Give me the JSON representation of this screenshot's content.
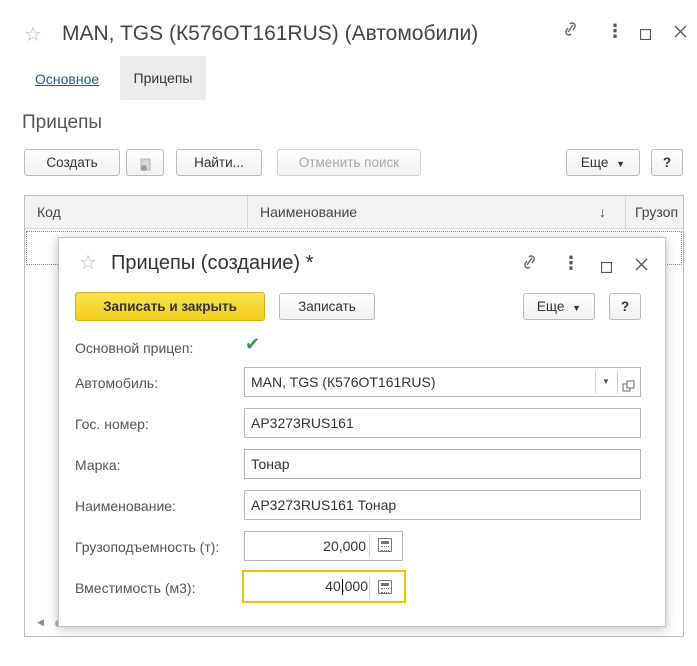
{
  "window": {
    "title": "MAN, TGS (К576ОТ161RUS) (Автомобили)",
    "icons": [
      "star-icon",
      "link-icon",
      "more-icon",
      "maximize-icon",
      "close-icon"
    ],
    "icon_glyphs": {
      "star": "☆",
      "link": "🔗",
      "more": "⋮",
      "maximize": "□",
      "close": "✕"
    }
  },
  "tabs": {
    "main": "Основное",
    "trailers": "Прицепы"
  },
  "section_title": "Прицепы",
  "toolbar": {
    "create": "Создать",
    "find": "Найти...",
    "cancel_search": "Отменить поиск",
    "more": "Еще",
    "help": "?"
  },
  "table": {
    "columns": [
      "Код",
      "Наименование",
      "↓",
      "Грузоп"
    ]
  },
  "modal": {
    "title": "Прицепы (создание) *",
    "save_close": "Записать и закрыть",
    "save": "Записать",
    "more": "Еще",
    "help": "?",
    "fields": {
      "main_trailer_label": "Основной прицеп:",
      "main_trailer_checked": true,
      "car_label": "Автомобиль:",
      "car_value": "MAN, TGS (К576ОТ161RUS)",
      "plate_label": "Гос. номер:",
      "plate_value": "АР3273RUS161",
      "brand_label": "Марка:",
      "brand_value": "Тонар",
      "name_label": "Наименование:",
      "name_value": "АР3273RUS161 Тонар",
      "capacity_label": "Грузоподъемность  (т):",
      "capacity_value": "20,000",
      "volume_label": "Вместимость (м3):",
      "volume_value": "40,000"
    }
  },
  "colors": {
    "accent_yellow": "#f2cf1a",
    "link_blue": "#1f5aa3",
    "check_green": "#2f9e44",
    "focus_border": "#f2c200"
  }
}
